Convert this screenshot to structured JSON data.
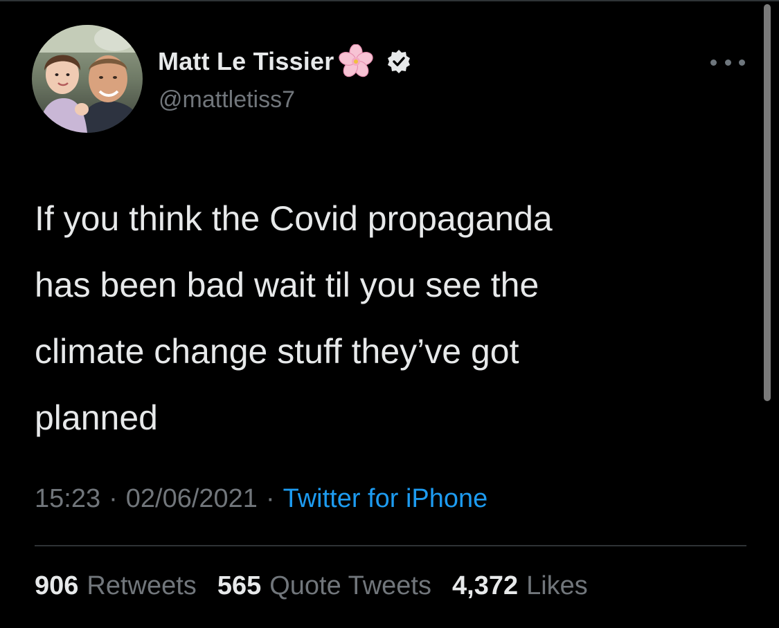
{
  "author": {
    "display_name": "Matt Le Tissier",
    "handle": "@mattletiss7"
  },
  "tweet": {
    "lines": [
      "If you think the Covid propaganda",
      "has been bad wait til you see the",
      "climate change stuff they’ve got",
      "planned"
    ]
  },
  "meta": {
    "time": "15:23",
    "separator": "·",
    "date": "02/06/2021",
    "source": "Twitter for iPhone"
  },
  "stats": {
    "retweets_count": "906",
    "retweets_label": "Retweets",
    "quotes_count": "565",
    "quotes_label": "Quote Tweets",
    "likes_count": "4,372",
    "likes_label": "Likes"
  },
  "icons": {
    "name_emoji": "cherry-blossom-icon",
    "verified": "verified-badge-icon",
    "more": "more-options-icon"
  },
  "colors": {
    "background": "#000000",
    "primary_text": "#e7e9ea",
    "secondary_text": "#71767b",
    "link": "#1d9bf0",
    "divider": "#2f3336"
  }
}
